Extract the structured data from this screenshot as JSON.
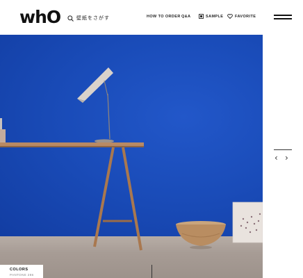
{
  "header": {
    "logo": "whO",
    "search_label": "壁紙をさがす",
    "nav": {
      "how_to_order": "HOW TO ORDER",
      "qa": "Q&A",
      "sample": "SAMPLE",
      "favorite": "FAVORITE"
    }
  },
  "hero": {
    "colors": {
      "title": "COLORS",
      "subtitle": "PANTONE 286"
    },
    "wall_color": "#1646b0"
  },
  "carousel": {
    "prev_icon": "‹",
    "next_icon": "›"
  }
}
